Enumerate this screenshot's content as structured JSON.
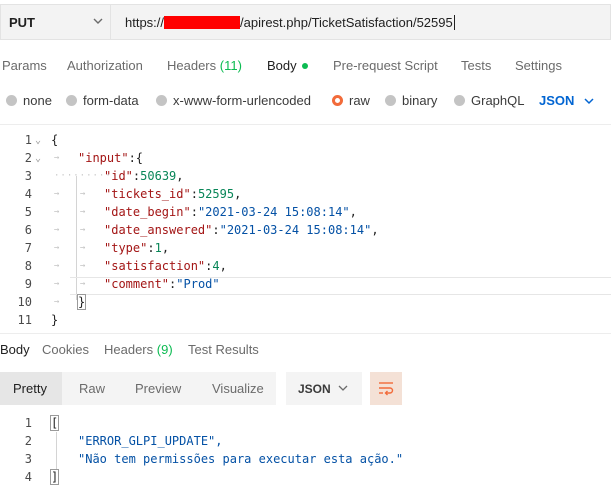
{
  "request": {
    "method": "PUT",
    "url_prefix": "https://",
    "url_suffix": "/apirest.php/TicketSatisfaction/52595"
  },
  "request_tabs": [
    {
      "label": "Params"
    },
    {
      "label": "Authorization"
    },
    {
      "label": "Headers",
      "count": "(11)"
    },
    {
      "label": "Body"
    },
    {
      "label": "Pre-request Script"
    },
    {
      "label": "Tests"
    },
    {
      "label": "Settings"
    }
  ],
  "body_types": [
    {
      "label": "none"
    },
    {
      "label": "form-data"
    },
    {
      "label": "x-www-form-urlencoded"
    },
    {
      "label": "raw"
    },
    {
      "label": "binary"
    },
    {
      "label": "GraphQL"
    }
  ],
  "body_language": "JSON",
  "request_body": {
    "line_numbers": [
      "1",
      "2",
      "3",
      "4",
      "5",
      "6",
      "7",
      "8",
      "9",
      "10",
      "11"
    ],
    "lines": [
      "{",
      "\"input\":{",
      "\"id\":50639,",
      "\"tickets_id\":52595,",
      "\"date_begin\":\"2021-03-24 15:08:14\",",
      "\"date_answered\":\"2021-03-24 15:08:14\",",
      "\"type\":1,",
      "\"satisfaction\":4,",
      "\"comment\":\"Prod\"",
      "}",
      "}"
    ],
    "parts": {
      "l2_key": "\"input\"",
      "l2_rest": ":{",
      "l3_key": "\"id\"",
      "l3_val": "50639",
      "l4_key": "\"tickets_id\"",
      "l4_val": "52595",
      "l5_key": "\"date_begin\"",
      "l5_val": "\"2021-03-24 15:08:14\"",
      "l6_key": "\"date_answered\"",
      "l6_val": "\"2021-03-24 15:08:14\"",
      "l7_key": "\"type\"",
      "l7_val": "1",
      "l8_key": "\"satisfaction\"",
      "l8_val": "4",
      "l9_key": "\"comment\"",
      "l9_val": "\"Prod\""
    }
  },
  "response_tabs": [
    {
      "label": "Body"
    },
    {
      "label": "Cookies"
    },
    {
      "label": "Headers",
      "count": "(9)"
    },
    {
      "label": "Test Results"
    }
  ],
  "response_views": [
    "Pretty",
    "Raw",
    "Preview",
    "Visualize"
  ],
  "response_format": "JSON",
  "response_body": {
    "line_numbers": [
      "1",
      "2",
      "3",
      "4"
    ],
    "l1": "[",
    "l2": "\"ERROR_GLPI_UPDATE\",",
    "l3": "\"Não tem permissões para executar esta ação.\"",
    "l4": "]"
  },
  "colors": {
    "accent_green": "#0cbb52",
    "accent_orange": "#f26b3a",
    "link_blue": "#0265d2",
    "redaction": "#ff0000"
  }
}
